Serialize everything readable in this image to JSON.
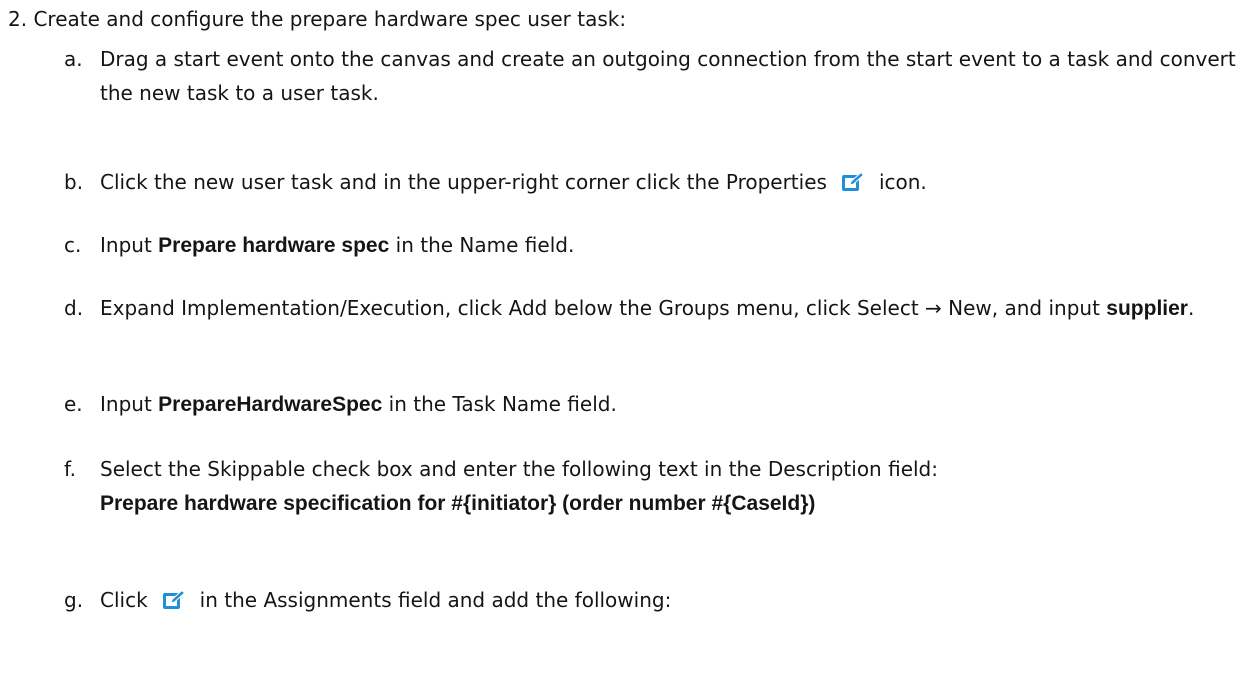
{
  "step": {
    "number": "2.",
    "title": "Create and configure the prepare hardware spec user task:"
  },
  "items": {
    "a": {
      "marker": "a.",
      "text": "Drag a start event onto the canvas and create an outgoing connection from the start event to a task and convert the new task to a user task."
    },
    "b": {
      "marker": "b.",
      "pre": "Click the new user task and in the upper-right corner click the ",
      "ui": "Properties",
      "post": "icon.",
      "icon": "edit-icon"
    },
    "c": {
      "marker": "c.",
      "pre": "Input ",
      "em": "Prepare hardware spec",
      "mid": " in the ",
      "ui": "Name",
      "post": " field."
    },
    "d": {
      "marker": "d.",
      "pre": "Expand ",
      "ui1": "Implementation/Execution",
      "mid1": ", click ",
      "ui2": "Add",
      "mid2": " below the ",
      "ui3": "Groups",
      "mid3": " menu, click ",
      "ui4": "Select → New",
      "mid4": ", and input ",
      "em": "supplier",
      "post": "."
    },
    "e": {
      "marker": "e.",
      "pre": "Input ",
      "em": "PrepareHardwareSpec",
      "mid": " in the ",
      "ui": "Task Name",
      "post": " field."
    },
    "f": {
      "marker": "f.",
      "pre": "Select the ",
      "ui1": "Skippable",
      "mid": " check box and enter the following text in the ",
      "ui2": "Description",
      "post": " field:",
      "em": "Prepare hardware specification for #{initiator} (order number #{CaseId})"
    },
    "g": {
      "marker": "g.",
      "pre": "Click",
      "mid": "in the ",
      "ui": "Assignments",
      "post": " field and add the following:",
      "icon": "edit-icon"
    }
  },
  "colors": {
    "text": "#151515",
    "icon_blue": "#1e8fd8"
  }
}
